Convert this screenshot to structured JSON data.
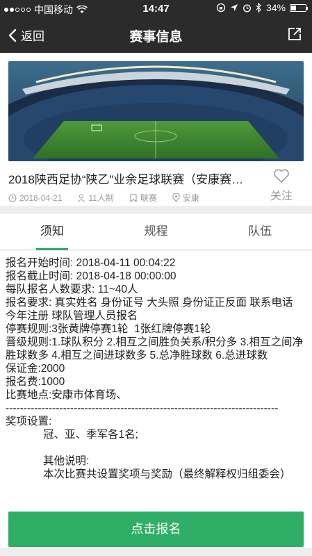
{
  "status_bar": {
    "carrier": "中国移动",
    "time": "14:47",
    "battery": "34%",
    "battery_level": 0.34
  },
  "nav": {
    "back_label": "返回",
    "title": "赛事信息"
  },
  "event": {
    "title": "2018陕西足协“陕乙”业余足球联赛（安康赛…",
    "date": "2018-04-21",
    "format": "11人制",
    "type": "联赛",
    "location": "安康",
    "follow_label": "关注"
  },
  "tabs": [
    {
      "label": "须知",
      "active": true
    },
    {
      "label": "规程",
      "active": false
    },
    {
      "label": "队伍",
      "active": false
    }
  ],
  "notice": {
    "lines": [
      "报名开始时间: 2018-04-11 00:04:22",
      "报名截止时间: 2018-04-18 00:00:00",
      "每队报名人数要求: 11~40人",
      "报名要求: 真实姓名 身份证号 大头照 身份证正反面 联系电话 今年注册 球队管理人员报名",
      "停赛规则:3张黄牌停赛1轮  1张红牌停赛1轮",
      "晋级规则:1.球队积分 2.相互之间胜负关系/积分多 3.相互之间净胜球数多 4.相互之间进球数多 5.总净胜球数 6.总进球数",
      "保证金:2000",
      "报名费:1000",
      "比赛地点:安康市体育场、"
    ],
    "divider": "----------------------------------------------------------------------------",
    "awards_heading": "奖项设置:",
    "awards_line": "冠、亚、季军各1名;",
    "other_heading": "其他说明:",
    "other_line": "本次比赛共设置奖项与奖励（最终解释权归组委会）"
  },
  "register_button": "点击报名",
  "colors": {
    "accent": "#2eae66",
    "bar": "#2b2b2b"
  }
}
